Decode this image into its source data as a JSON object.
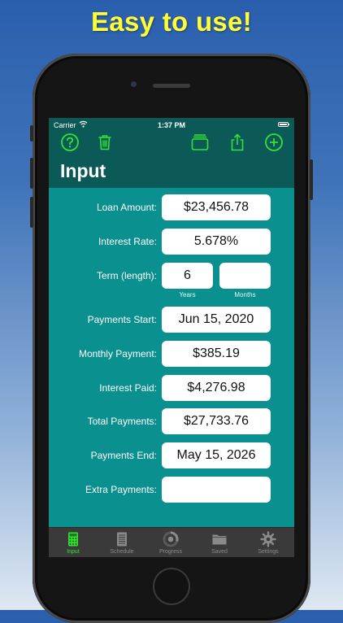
{
  "headline": "Easy to use!",
  "status_bar": {
    "carrier": "Carrier",
    "time": "1:37 PM"
  },
  "toolbar": {
    "icons": [
      "help-icon",
      "trash-icon",
      "stack-icon",
      "share-icon",
      "add-icon"
    ],
    "accent_color": "#33e233"
  },
  "page_title": "Input",
  "form": {
    "loan_amount": {
      "label": "Loan Amount:",
      "value": "$23,456.78"
    },
    "interest_rate": {
      "label": "Interest Rate:",
      "value": "5.678%"
    },
    "term": {
      "label": "Term (length):",
      "years_value": "6",
      "months_value": "",
      "years_label": "Years",
      "months_label": "Months"
    },
    "payments_start": {
      "label": "Payments Start:",
      "value": "Jun 15, 2020"
    },
    "monthly_payment": {
      "label": "Monthly Payment:",
      "value": "$385.19"
    },
    "interest_paid": {
      "label": "Interest Paid:",
      "value": "$4,276.98"
    },
    "total_payments": {
      "label": "Total Payments:",
      "value": "$27,733.76"
    },
    "payments_end": {
      "label": "Payments End:",
      "value": "May 15, 2026"
    },
    "extra_payments": {
      "label": "Extra Payments:",
      "value": ""
    }
  },
  "tabs": [
    {
      "label": "Input",
      "icon": "calculator-icon",
      "active": true
    },
    {
      "label": "Schedule",
      "icon": "schedule-icon",
      "active": false
    },
    {
      "label": "Progress",
      "icon": "progress-icon",
      "active": false
    },
    {
      "label": "Saved",
      "icon": "folder-icon",
      "active": false
    },
    {
      "label": "Settings",
      "icon": "gear-icon",
      "active": false
    }
  ],
  "colors": {
    "screen_bg": "#0a908e",
    "header_bg": "#0b5a58",
    "tabbar_bg": "#3a3a3a",
    "headline_color": "#ffff33"
  }
}
